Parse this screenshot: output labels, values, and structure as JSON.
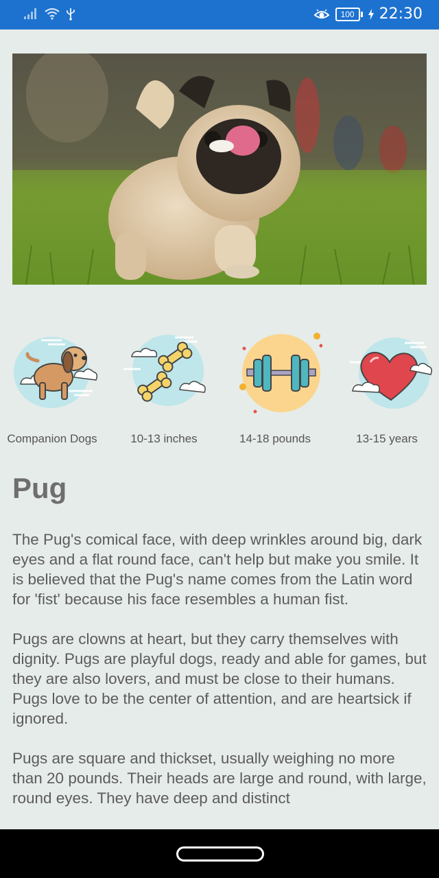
{
  "status_bar": {
    "time": "22:30",
    "battery": "100",
    "icons": [
      "signal-icon",
      "wifi-icon",
      "usb-icon",
      "eye-comfort-icon",
      "battery-icon",
      "charging-icon"
    ]
  },
  "hero": {
    "image": "pug-running-on-grass-photo"
  },
  "traits": [
    {
      "icon": "companion-dog-icon",
      "label": "Companion Dogs"
    },
    {
      "icon": "height-bones-icon",
      "label": "10-13 inches"
    },
    {
      "icon": "weight-dumbbell-icon",
      "label": "14-18 pounds"
    },
    {
      "icon": "lifespan-heart-icon",
      "label": "13-15 years"
    }
  ],
  "breed": {
    "name": "Pug",
    "paragraphs": [
      "The Pug's comical face, with deep wrinkles around big, dark eyes and a flat round face, can't help but make you smile. It is believed that the Pug's name comes from the Latin word for 'fist' because his face resembles a human fist.",
      "Pugs are clowns at heart, but they carry themselves with dignity. Pugs are playful dogs, ready and able for games, but they are also lovers, and must be close to their humans. Pugs love to be the center of attention, and are heartsick if ignored.",
      "Pugs are square and thickset, usually weighing no more than 20 pounds. Their heads are large and round, with large, round eyes. They have deep and distinct"
    ]
  },
  "colors": {
    "status_bar": "#1d72d0",
    "background": "#e6ece9",
    "nav_bar": "#000000"
  }
}
